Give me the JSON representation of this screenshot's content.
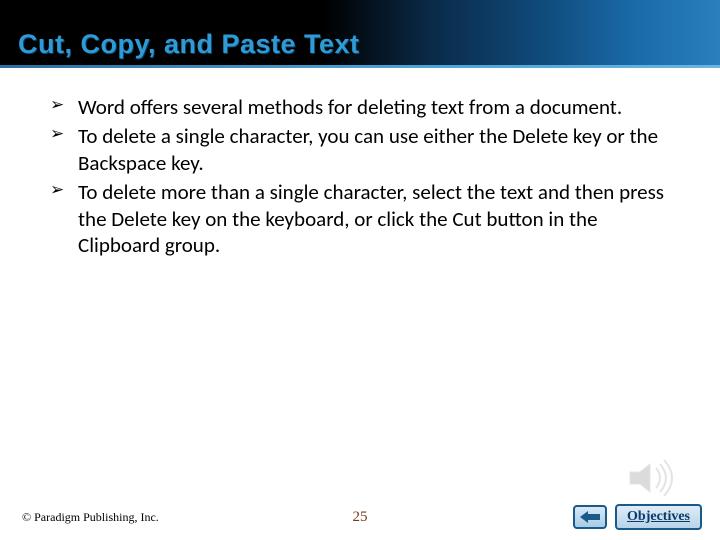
{
  "title": "Cut, Copy, and Paste Text",
  "bullets": [
    "Word offers several methods for deleting text from a document.",
    "To delete a single character, you can use either the Delete key or the Backspace key.",
    "To delete more than a single character, select the text and then press the Delete key on the keyboard, or click the Cut button in the Clipboard group."
  ],
  "footer": {
    "copyright": "© Paradigm Publishing, Inc.",
    "page_number": "25",
    "objectives_label": "Objectives"
  }
}
